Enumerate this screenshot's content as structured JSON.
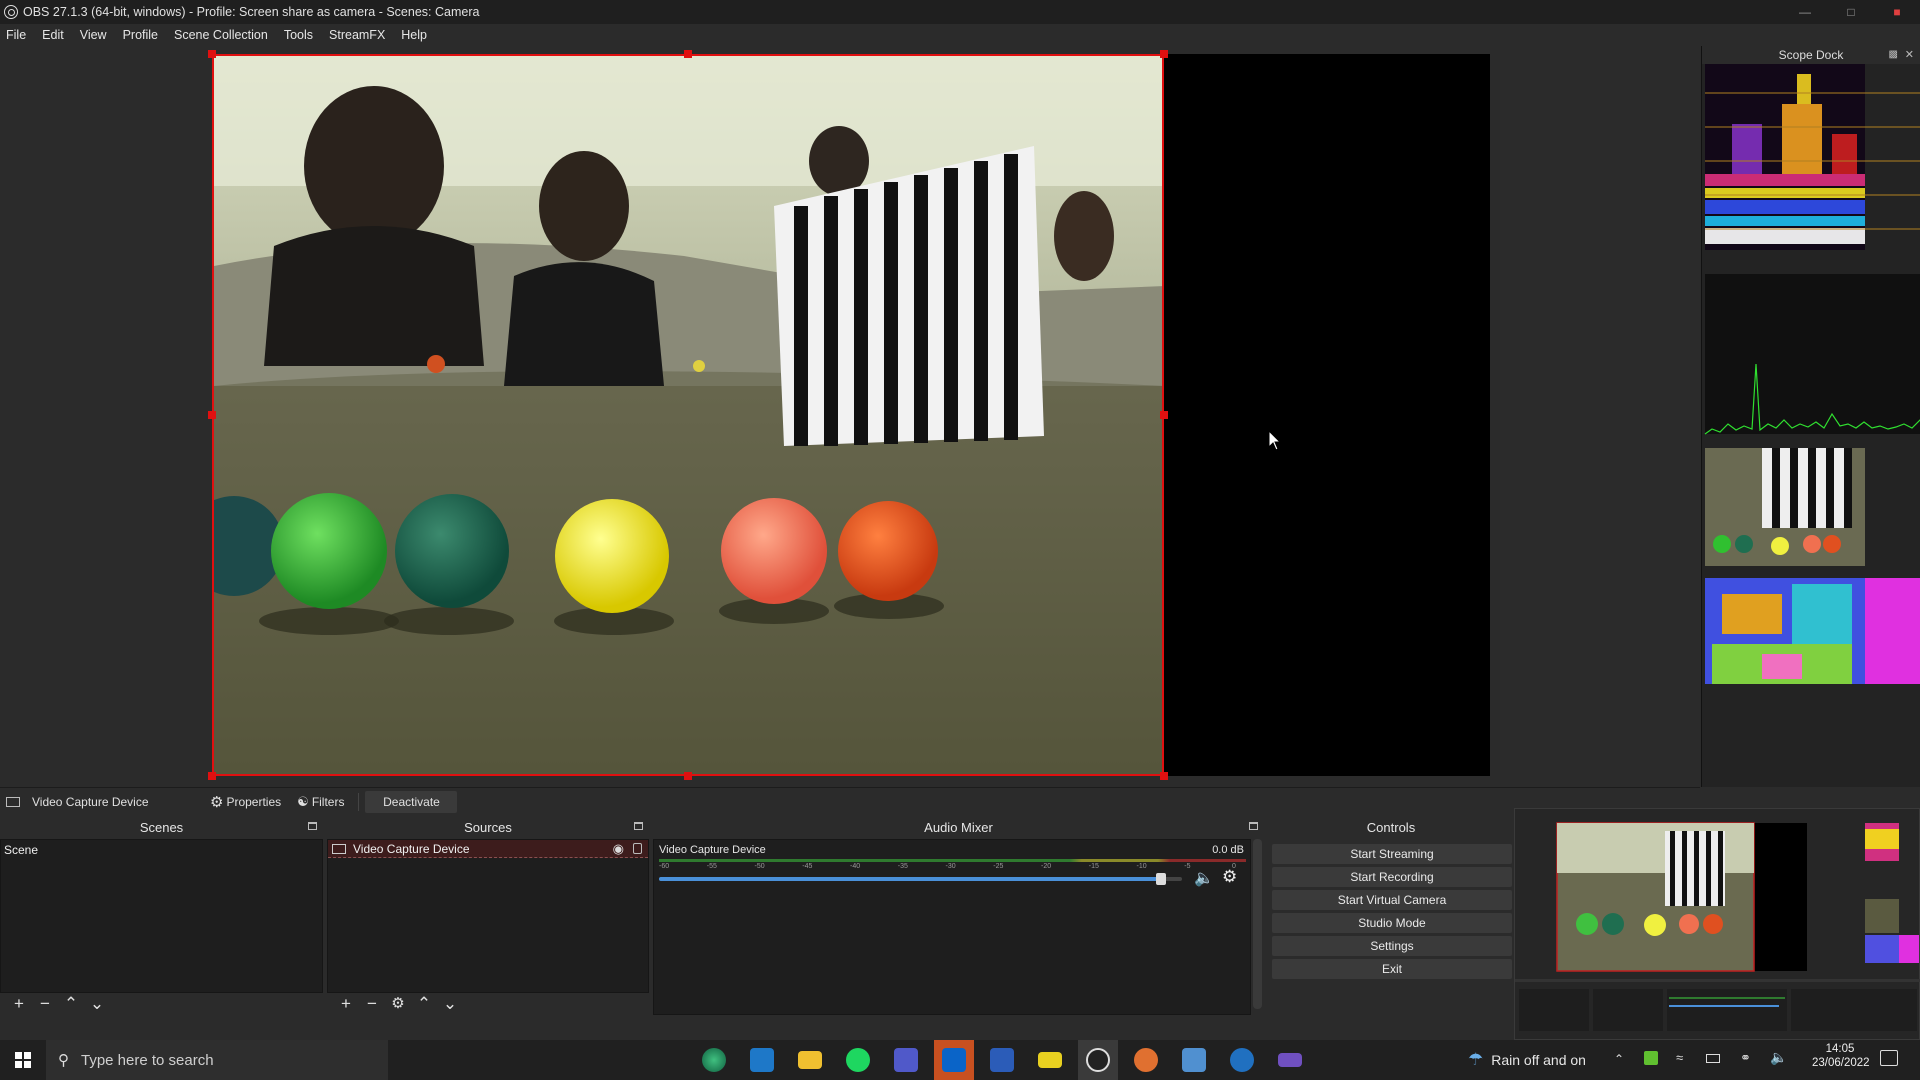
{
  "window": {
    "title": "OBS 27.1.3 (64-bit, windows) - Profile: Screen share as camera - Scenes: Camera"
  },
  "menu": [
    "File",
    "Edit",
    "View",
    "Profile",
    "Scene Collection",
    "Tools",
    "StreamFX",
    "Help"
  ],
  "scope_dock": {
    "title": "Scope Dock"
  },
  "source_toolbar": {
    "source_name": "Video Capture Device",
    "properties": "Properties",
    "filters": "Filters",
    "deactivate": "Deactivate"
  },
  "scenes": {
    "title": "Scenes",
    "items": [
      "Scene"
    ]
  },
  "sources": {
    "title": "Sources",
    "items": [
      "Video Capture Device"
    ]
  },
  "audio_mixer": {
    "title": "Audio Mixer",
    "channel": "Video Capture Device",
    "level": "0.0 dB",
    "ticks": [
      "-60",
      "-55",
      "-50",
      "-45",
      "-40",
      "-35",
      "-30",
      "-25",
      "-20",
      "-15",
      "-10",
      "-5",
      "0"
    ],
    "volume_fraction": 0.97
  },
  "controls": {
    "title": "Controls",
    "buttons": [
      "Start Streaming",
      "Start Recording",
      "Start Virtual Camera",
      "Studio Mode",
      "Settings",
      "Exit"
    ]
  },
  "taskbar": {
    "search_placeholder": "Type here to search",
    "weather": "Rain off and on",
    "time": "14:05",
    "date": "23/06/2022"
  },
  "colors": {
    "selection": "#e01010",
    "accent": "#4a90d9"
  }
}
